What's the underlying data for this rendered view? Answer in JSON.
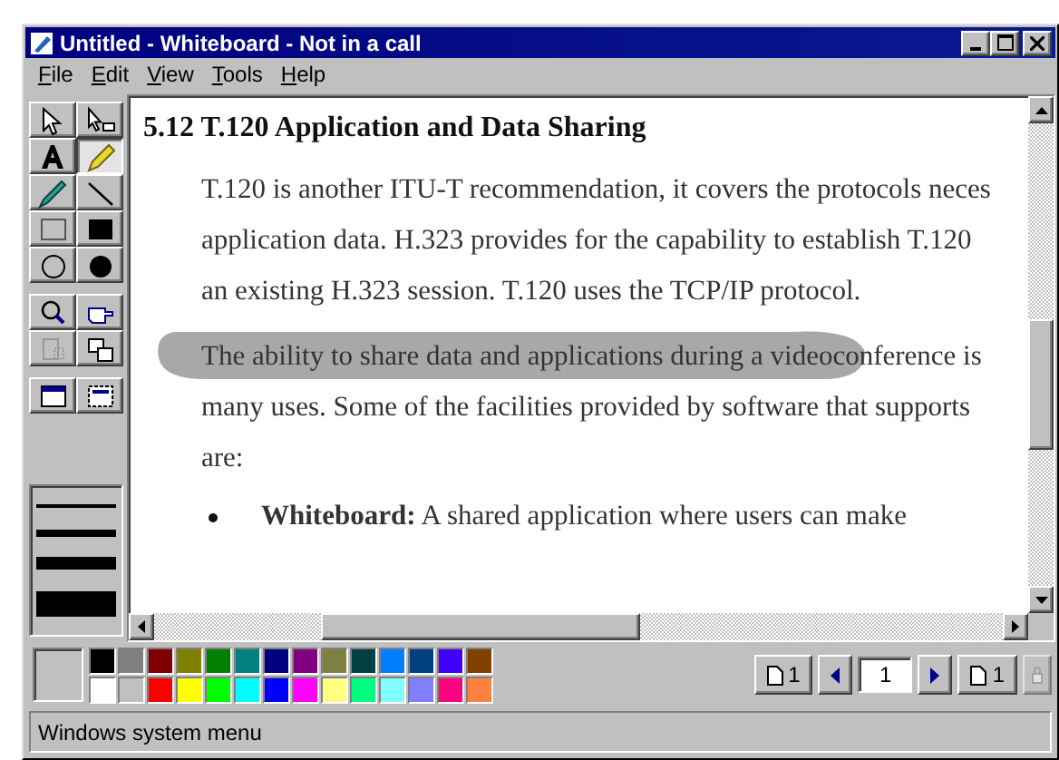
{
  "window": {
    "title": "Untitled - Whiteboard - Not in a call"
  },
  "menu": [
    "File",
    "Edit",
    "View",
    "Tools",
    "Help"
  ],
  "tool_groups": [
    {
      "tools": [
        {
          "kind": "select",
          "selected": false
        },
        {
          "kind": "eraser",
          "selected": false
        },
        {
          "kind": "text",
          "selected": false
        },
        {
          "kind": "highlighter",
          "selected": true
        },
        {
          "kind": "pen",
          "selected": false
        },
        {
          "kind": "line",
          "selected": false
        },
        {
          "kind": "rect",
          "selected": false
        },
        {
          "kind": "filled-rect",
          "selected": false
        },
        {
          "kind": "ellipse",
          "selected": false
        },
        {
          "kind": "filled-ellipse",
          "selected": false
        }
      ]
    },
    {
      "tools": [
        {
          "kind": "zoom",
          "selected": false
        },
        {
          "kind": "pointer",
          "selected": false
        },
        {
          "kind": "select-area",
          "selected": false
        },
        {
          "kind": "select-window",
          "selected": false
        }
      ]
    },
    {
      "tools": [
        {
          "kind": "window-capture",
          "selected": false
        },
        {
          "kind": "area-capture",
          "selected": false
        }
      ]
    }
  ],
  "document": {
    "heading": "5.12 T.120 Application and Data Sharing",
    "paragraphs": [
      {
        "lines": [
          "T.120 is another ITU-T recommendation, it covers the protocols neces",
          "application data.  H.323 provides for the capability to establish T.120",
          "an existing H.323 session.  T.120 uses the TCP/IP protocol."
        ],
        "highlighted": false
      },
      {
        "lines": [
          "The ability to share data and applications during a videoconference is",
          "many uses.  Some of the facilities provided by software that supports",
          "are:"
        ],
        "highlighted": true
      }
    ],
    "bullets": [
      "**Whiteboard:** A shared application where users can make"
    ]
  },
  "palette": {
    "colors": [
      {
        "color": "#000000"
      },
      {
        "color": "#808080"
      },
      {
        "color": "#800000"
      },
      {
        "color": "#808000"
      },
      {
        "color": "#008000"
      },
      {
        "color": "#008080"
      },
      {
        "color": "#000080"
      },
      {
        "color": "#800080"
      },
      {
        "color": "#808040"
      },
      {
        "color": "#004040"
      },
      {
        "color": "#0080ff"
      },
      {
        "color": "#004080"
      },
      {
        "color": "#4000ff"
      },
      {
        "color": "#804000"
      },
      {
        "color": "#ffffff"
      },
      {
        "color": "#c0c0c0"
      },
      {
        "color": "#ff0000"
      },
      {
        "color": "#ffff00"
      },
      {
        "color": "#00ff00"
      },
      {
        "color": "#00ffff"
      },
      {
        "color": "#0000ff"
      },
      {
        "color": "#ff00ff"
      },
      {
        "color": "#ffff80"
      },
      {
        "color": "#00ff80"
      },
      {
        "color": "#80ffff"
      },
      {
        "color": "#8080ff"
      },
      {
        "color": "#ff0080"
      },
      {
        "color": "#ff8040"
      }
    ]
  },
  "page_nav": {
    "insert_before": "1",
    "page": "1",
    "insert_after": "1",
    "lock_disabled": true
  },
  "status_bar": "Windows system menu"
}
